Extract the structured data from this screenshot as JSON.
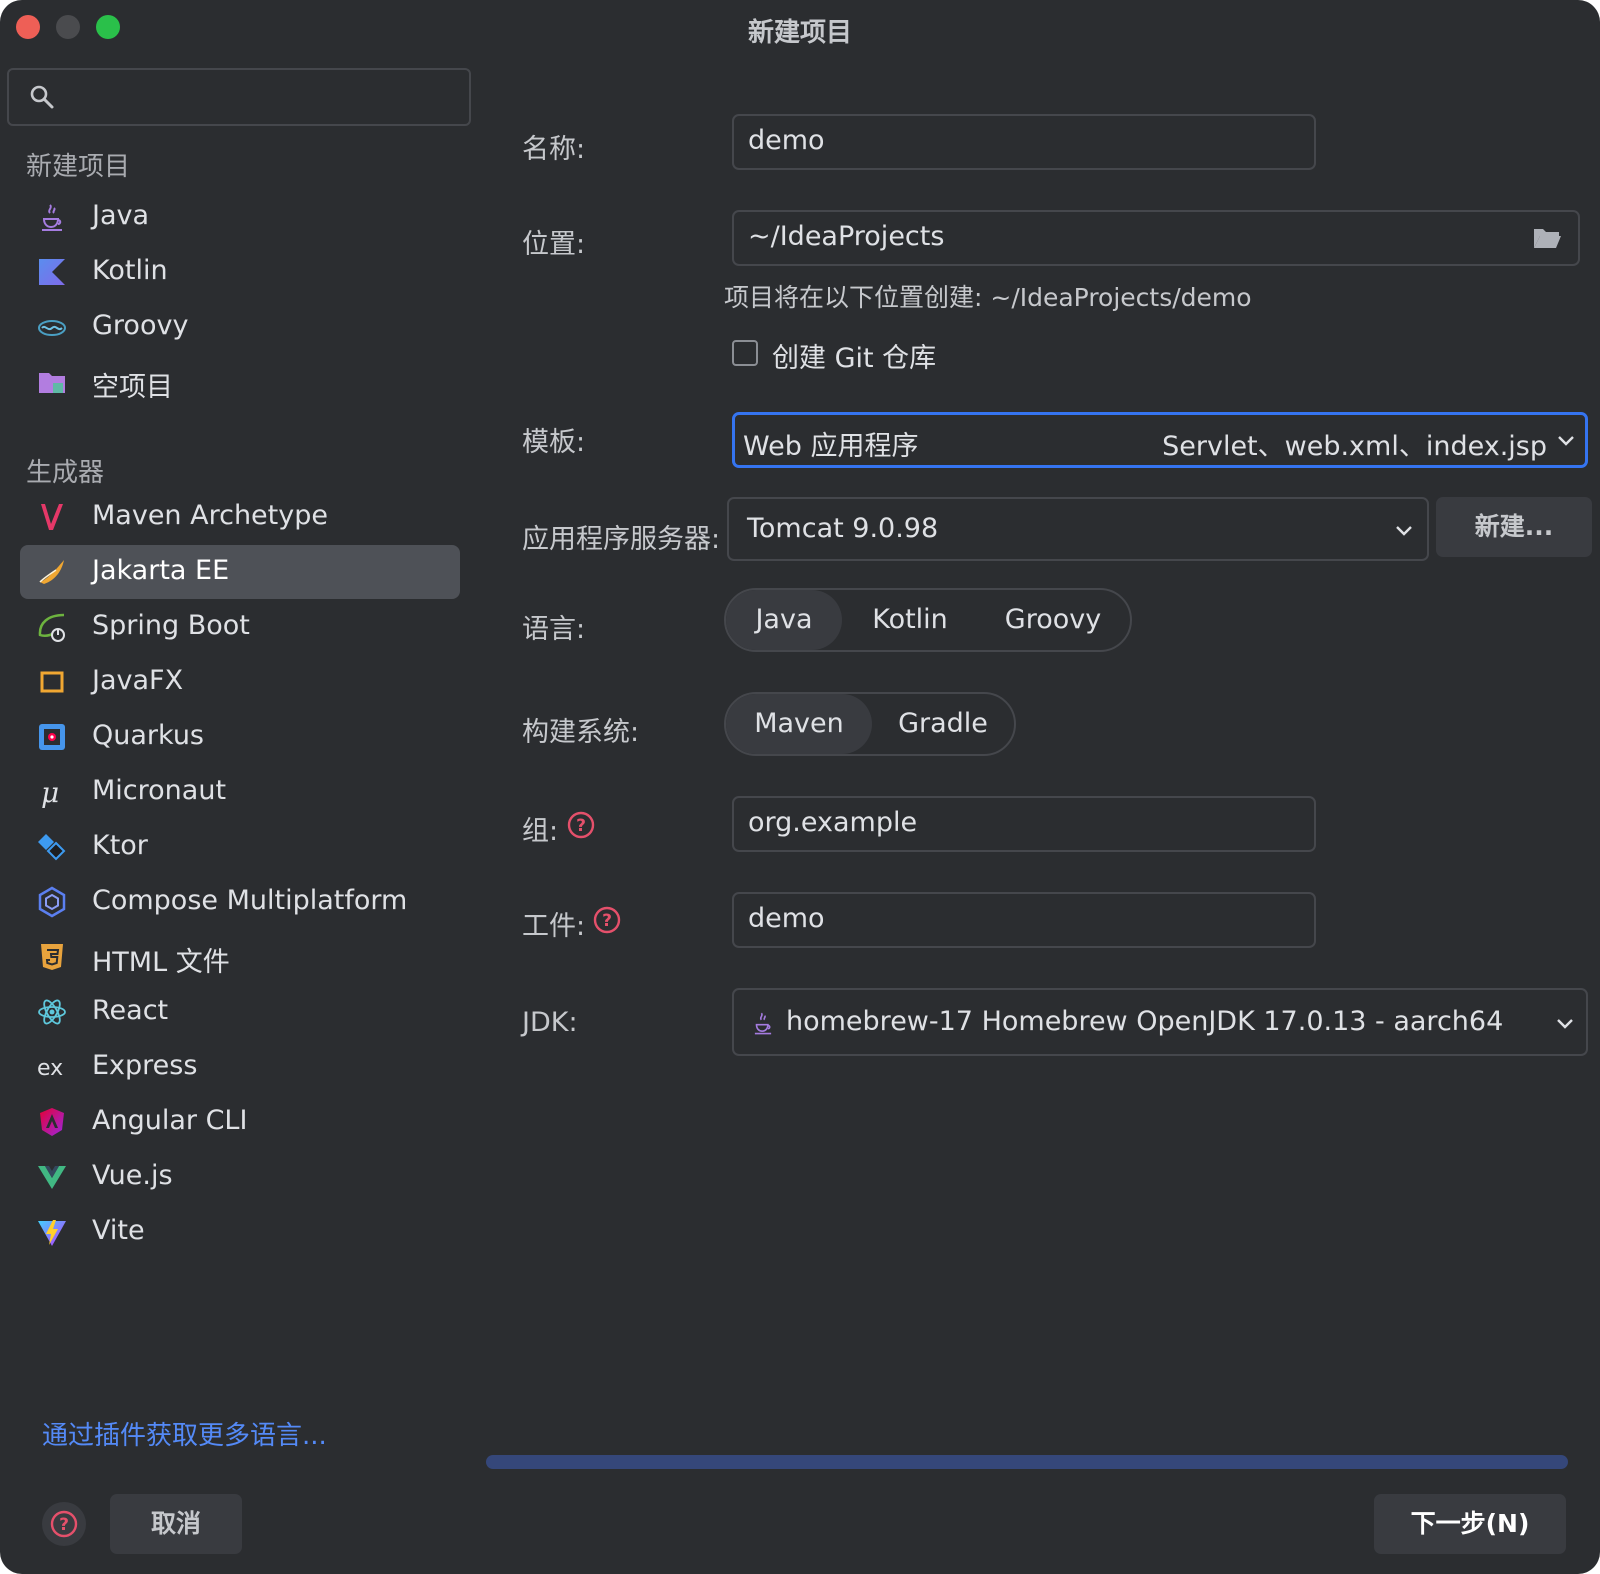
{
  "window": {
    "title": "新建项目"
  },
  "search": {
    "value": "",
    "placeholder": ""
  },
  "sidebar": {
    "section_new_project": "新建项目",
    "new_project_items": [
      {
        "label": "Java",
        "icon": "java-icon"
      },
      {
        "label": "Kotlin",
        "icon": "kotlin-icon"
      },
      {
        "label": "Groovy",
        "icon": "groovy-icon"
      },
      {
        "label": "空项目",
        "icon": "empty-project-folder-icon"
      }
    ],
    "section_generators": "生成器",
    "generator_items": [
      {
        "label": "Maven Archetype",
        "icon": "maven-icon"
      },
      {
        "label": "Jakarta EE",
        "icon": "jakarta-ee-icon",
        "selected": true
      },
      {
        "label": "Spring Boot",
        "icon": "spring-boot-icon"
      },
      {
        "label": "JavaFX",
        "icon": "javafx-icon"
      },
      {
        "label": "Quarkus",
        "icon": "quarkus-icon"
      },
      {
        "label": "Micronaut",
        "icon": "micronaut-icon"
      },
      {
        "label": "Ktor",
        "icon": "ktor-icon"
      },
      {
        "label": "Compose Multiplatform",
        "icon": "compose-icon"
      },
      {
        "label": "HTML 文件",
        "icon": "html5-icon"
      },
      {
        "label": "React",
        "icon": "react-icon"
      },
      {
        "label": "Express",
        "icon": "express-icon"
      },
      {
        "label": "Angular CLI",
        "icon": "angular-icon"
      },
      {
        "label": "Vue.js",
        "icon": "vue-icon"
      },
      {
        "label": "Vite",
        "icon": "vite-icon"
      }
    ],
    "plugins_link": "通过插件获取更多语言..."
  },
  "form": {
    "name_label": "名称:",
    "name_value": "demo",
    "location_label": "位置:",
    "location_value": "~/IdeaProjects",
    "location_hint": "项目将在以下位置创建: ~/IdeaProjects/demo",
    "git_checkbox_label": "创建 Git 仓库",
    "git_checked": false,
    "template_label": "模板:",
    "template_value": "Web 应用程序",
    "template_detail": "Servlet、web.xml、index.jsp",
    "server_label": "应用程序服务器:",
    "server_value": "Tomcat 9.0.98",
    "server_new_button": "新建...",
    "language_label": "语言:",
    "languages": [
      "Java",
      "Kotlin",
      "Groovy"
    ],
    "language_selected": "Java",
    "build_label": "构建系统:",
    "build_systems": [
      "Maven",
      "Gradle"
    ],
    "build_selected": "Maven",
    "group_label": "组:",
    "group_value": "org.example",
    "artifact_label": "工件:",
    "artifact_value": "demo",
    "jdk_label": "JDK:",
    "jdk_value": "homebrew-17  Homebrew OpenJDK 17.0.13 - aarch64"
  },
  "footer": {
    "cancel": "取消",
    "next": "下一步(N)"
  },
  "colors": {
    "accent": "#3574f0",
    "link": "#548af7",
    "help_icon": "#e5506b",
    "background": "#2b2d30",
    "selection": "#4e5157"
  }
}
